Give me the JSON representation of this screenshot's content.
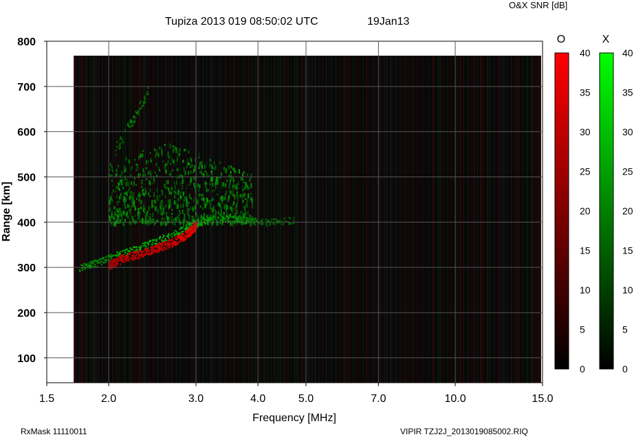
{
  "chart_data": {
    "type": "heatmap",
    "title": "Tupiza 2013 019 08:50:02 UTC",
    "date_label": "19Jan13",
    "colorbar_title": "O&X SNR [dB]",
    "xlabel": "Frequency [MHz]",
    "ylabel": "Range [km]",
    "x_scale": "log",
    "xlim": [
      1.5,
      15.0
    ],
    "ylim": [
      45,
      800
    ],
    "x_ticks": [
      1.5,
      2.0,
      3.0,
      4.0,
      5.0,
      7.0,
      10.0,
      15.0
    ],
    "x_tick_labels": [
      "1.5",
      "2.0",
      "3.0",
      "4.0",
      "5.0",
      "7.0",
      "10.0",
      "15.0"
    ],
    "y_ticks": [
      100,
      200,
      300,
      400,
      500,
      600,
      700,
      800
    ],
    "y_tick_labels": [
      "100",
      "200",
      "300",
      "400",
      "500",
      "600",
      "700",
      "800"
    ],
    "data_extent": {
      "freq": [
        1.7,
        14.9
      ],
      "range": [
        45,
        768
      ]
    },
    "grid": true,
    "colorbars": [
      {
        "name": "O",
        "range": [
          0,
          40
        ],
        "ticks": [
          "40",
          "35",
          "30",
          "25",
          "20",
          "15",
          "10",
          "5",
          "0"
        ],
        "colors": [
          "#000000",
          "#ff0000"
        ]
      },
      {
        "name": "X",
        "range": [
          0,
          40
        ],
        "ticks": [
          "40",
          "35",
          "30",
          "25",
          "20",
          "15",
          "10",
          "5",
          "0"
        ],
        "colors": [
          "#000000",
          "#00ff00"
        ]
      }
    ],
    "o_trace": {
      "freq": [
        2.0,
        2.05,
        2.15,
        2.3,
        2.45,
        2.6,
        2.75,
        2.9,
        3.0
      ],
      "range": [
        305,
        312,
        322,
        330,
        340,
        350,
        362,
        378,
        395
      ],
      "snr": [
        18,
        22,
        25,
        26,
        28,
        30,
        32,
        34,
        30
      ]
    },
    "x_trace": {
      "freq": [
        1.75,
        1.85,
        1.95,
        2.1,
        2.3,
        2.5,
        2.7,
        2.9,
        3.1,
        3.4,
        3.7,
        3.9,
        4.2,
        4.75
      ],
      "range": [
        300,
        308,
        316,
        330,
        345,
        360,
        375,
        392,
        405,
        410,
        408,
        404,
        400,
        405
      ],
      "snr": [
        18,
        16,
        14,
        22,
        24,
        25,
        26,
        24,
        22,
        20,
        18,
        12,
        8,
        10
      ]
    },
    "x_spread": {
      "freq_range": [
        2.0,
        3.9
      ],
      "range_range": [
        400,
        580
      ],
      "peak_snr": 26
    }
  },
  "footer": {
    "left": "RxMask 11110011",
    "right": "VIPIR  TZJ2J_2013019085002.RIQ"
  }
}
